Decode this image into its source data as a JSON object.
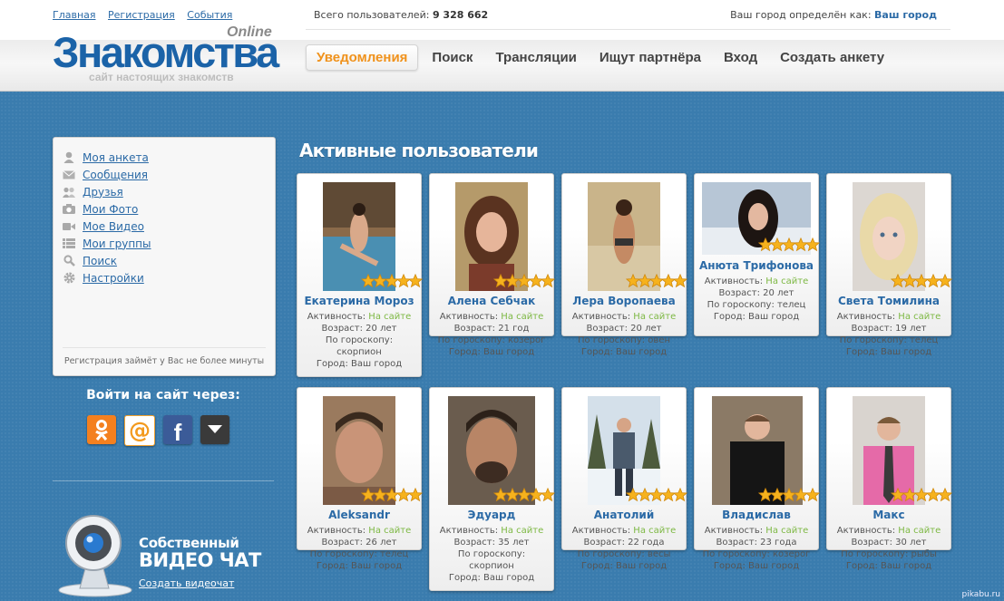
{
  "top_links": [
    "Главная",
    "Регистрация",
    "События"
  ],
  "users_label": "Всего пользователей:",
  "users_count": "9 328 662",
  "city_label": "Ваш город определён как:",
  "city_link": "Ваш город",
  "logo": {
    "title": "Знакомства",
    "badge": "Online",
    "tagline": "сайт настоящих знакомств"
  },
  "nav": [
    "Уведомления",
    "Поиск",
    "Трансляции",
    "Ищут партнёра",
    "Вход",
    "Создать анкету"
  ],
  "sidebar": {
    "items": [
      "Моя анкета",
      "Сообщения",
      "Друзья",
      "Мои Фото",
      "Мое Видео",
      "Мои группы",
      "Поиск",
      "Настройки"
    ],
    "note": "Регистрация займёт у Вас не более минуты"
  },
  "login_title": "Войти на сайт через:",
  "videochat": {
    "line1": "Собственный",
    "line2": "ВИДЕО ЧАТ",
    "link": "Создать видеочат"
  },
  "section_title": "Активные пользователи",
  "activity_label": "Активность:",
  "online_label": "На сайте",
  "city_value": "Город: Ваш город",
  "users": [
    {
      "name": "Екатерина Мороз",
      "age": "Возраст: 20 лет",
      "sign_lines": [
        "По гороскопу:",
        "скорпион"
      ],
      "rating": 5
    },
    {
      "name": "Алена Себчак",
      "age": "Возраст: 21 год",
      "sign_lines": [
        "По гороскопу: козерог"
      ],
      "rating": 5
    },
    {
      "name": "Лера Воропаева",
      "age": "Возраст: 20 лет",
      "sign_lines": [
        "По гороскопу: овен"
      ],
      "rating": 5
    },
    {
      "name": "Анюта Трифонова",
      "age": "Возраст: 20 лет",
      "sign_lines": [
        "По гороскопу: телец"
      ],
      "rating": 5
    },
    {
      "name": "Света Томилина",
      "age": "Возраст: 19 лет",
      "sign_lines": [
        "По гороскопу: телец"
      ],
      "rating": 5
    },
    {
      "name": "Aleksandr",
      "age": "Возраст: 26 лет",
      "sign_lines": [
        "По гороскопу: телец"
      ],
      "rating": 5
    },
    {
      "name": "Эдуард",
      "age": "Возраст: 35 лет",
      "sign_lines": [
        "По гороскопу:",
        "скорпион"
      ],
      "rating": 5
    },
    {
      "name": "Анатолий",
      "age": "Возраст: 22 года",
      "sign_lines": [
        "По гороскопу: весы"
      ],
      "rating": 5
    },
    {
      "name": "Владислав",
      "age": "Возраст: 23 года",
      "sign_lines": [
        "По гороскопу: козерог"
      ],
      "rating": 5
    },
    {
      "name": "Макс",
      "age": "Возраст: 30 лет",
      "sign_lines": [
        "По гороскопу: рыбы"
      ],
      "rating": 5
    }
  ],
  "watermark": "pikabu.ru",
  "colors": {
    "link": "#2b6aa6",
    "accent": "#f0921c",
    "online": "#7db843",
    "background": "#3a7cae"
  }
}
